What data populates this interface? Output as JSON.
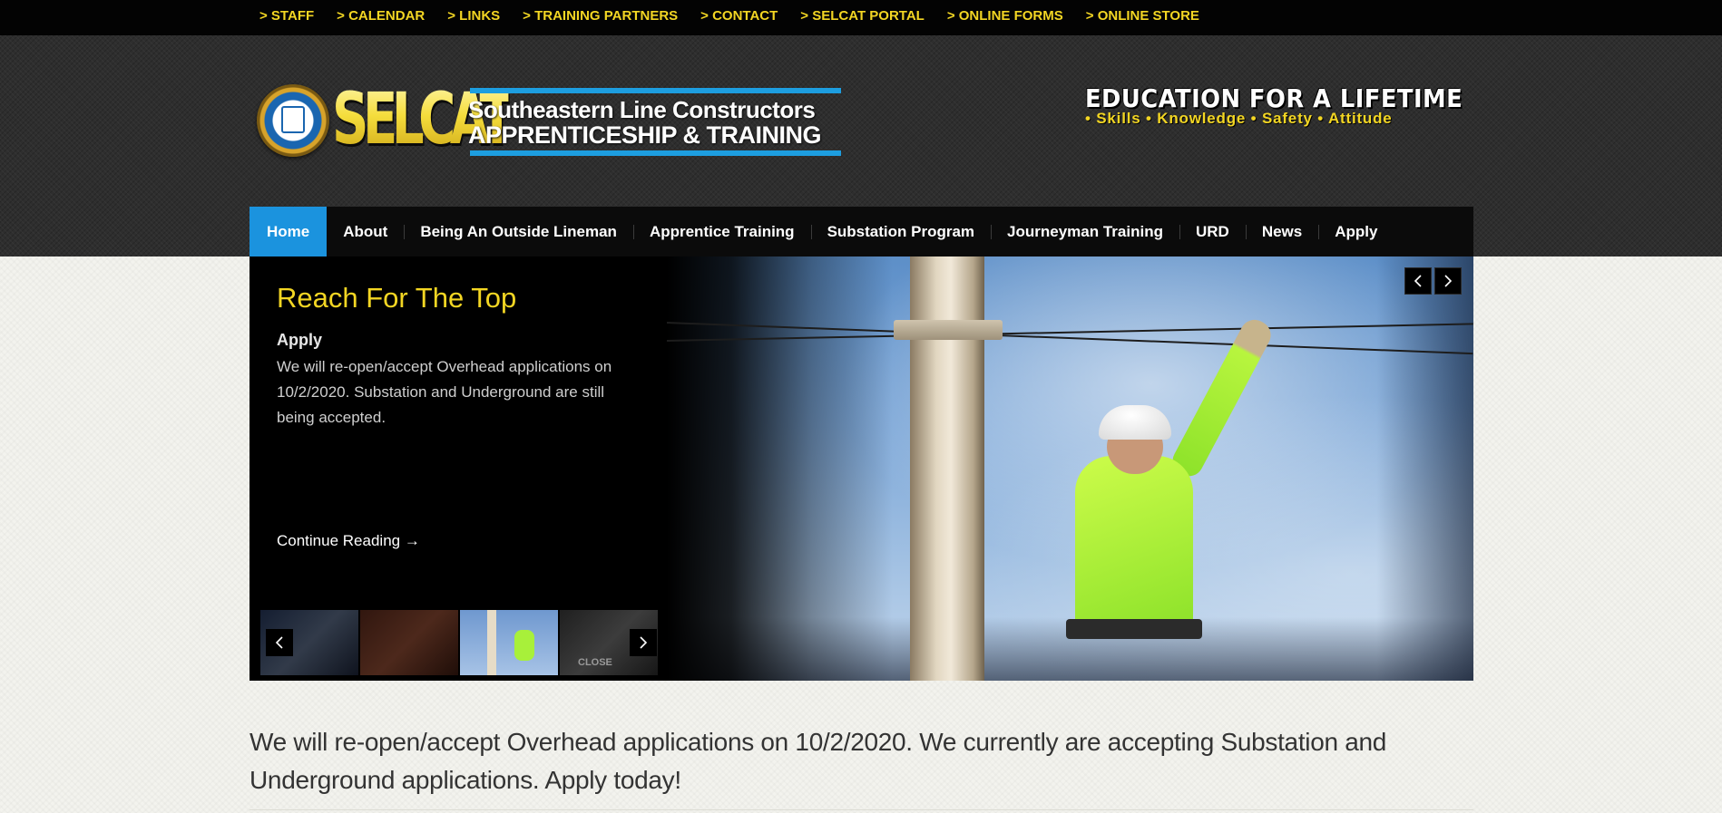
{
  "topbar": {
    "links": [
      "> STAFF",
      "> CALENDAR",
      "> LINKS",
      "> TRAINING PARTNERS",
      "> CONTACT",
      "> SELCAT PORTAL",
      "> ONLINE FORMS",
      "> ONLINE STORE"
    ]
  },
  "logo": {
    "wordmark": "SELCAT",
    "tagline_line1": "Southeastern Line Constructors",
    "tagline_line2": "APPRENTICESHIP & TRAINING"
  },
  "motto": {
    "title": "EDUCATION FOR A LIFETIME",
    "subtitle": "• Skills • Knowledge • Safety • Attitude"
  },
  "nav": {
    "items": [
      "Home",
      "About",
      "Being An Outside Lineman",
      "Apprentice Training",
      "Substation Program",
      "Journeyman Training",
      "URD",
      "News",
      "Apply"
    ],
    "active_index": 0
  },
  "slider": {
    "title": "Reach For The Top",
    "subtitle": "Apply",
    "text": "We will re-open/accept Overhead applications on 10/2/2020. Substation and Underground are still being accepted.",
    "more_label": "Continue Reading →",
    "thumb_caption": "CLOSE"
  },
  "announcement": {
    "text": "We will re-open/accept Overhead applications on 10/2/2020. We currently are accepting Substation and Underground applications. Apply today!"
  },
  "colors": {
    "accent_yellow": "#f3d623",
    "active_blue": "#1b93de",
    "topbar_bg": "#030303"
  }
}
